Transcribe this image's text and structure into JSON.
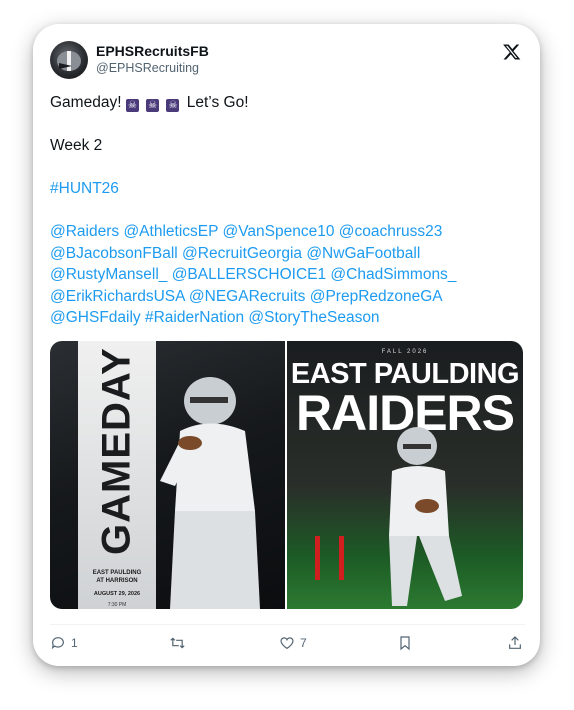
{
  "author": {
    "name": "EPHSRecruitsFB",
    "handle": "@EPHSRecruiting"
  },
  "post": {
    "line1_prefix": "Gameday! ",
    "line1_emoji": [
      "☠",
      "☠",
      "☠"
    ],
    "line1_suffix": "Let’s Go!",
    "line2": "Week 2",
    "hashtag": "#HUNT26",
    "mentions_lines": [
      "@Raiders @AthleticsEP @VanSpence10 @coachruss23",
      "@BJacobsonFBall @RecruitGeorgia @NwGaFootball",
      "@RustyMansell_ @BALLERSCHOICE1 @ChadSimmons_",
      "@ErikRichardsUSA @NEGARecruits @PrepRedzoneGA",
      "@GHSFdaily #RaiderNation @StoryTheSeason"
    ]
  },
  "media": {
    "left": {
      "banner": "GAMEDAY",
      "matchup": "EAST PAULDING",
      "opponent": "AT HARRISON",
      "date": "AUGUST 29, 2026",
      "time": "7:30 PM"
    },
    "right": {
      "season": "FALL 2026",
      "team_line1": "EAST PAULDING",
      "team_line2": "RAIDERS"
    }
  },
  "actions": {
    "replies": "1",
    "reposts": "",
    "likes": "7"
  },
  "colors": {
    "accent_link": "#1d9bf0",
    "text_primary": "#0f1419",
    "text_secondary": "#536471"
  }
}
